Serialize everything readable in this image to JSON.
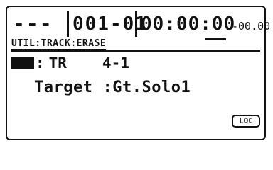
{
  "status": {
    "mode": "---",
    "bar": "001-01",
    "time": "00:00:00",
    "sub": "-00.00"
  },
  "breadcrumb": "UTIL:TRACK:ERASE",
  "track": {
    "label": "TR",
    "value": "4-1"
  },
  "target": {
    "label": "Target",
    "value": "Gt.Solo1"
  },
  "buttons": {
    "loc": "LOC"
  }
}
